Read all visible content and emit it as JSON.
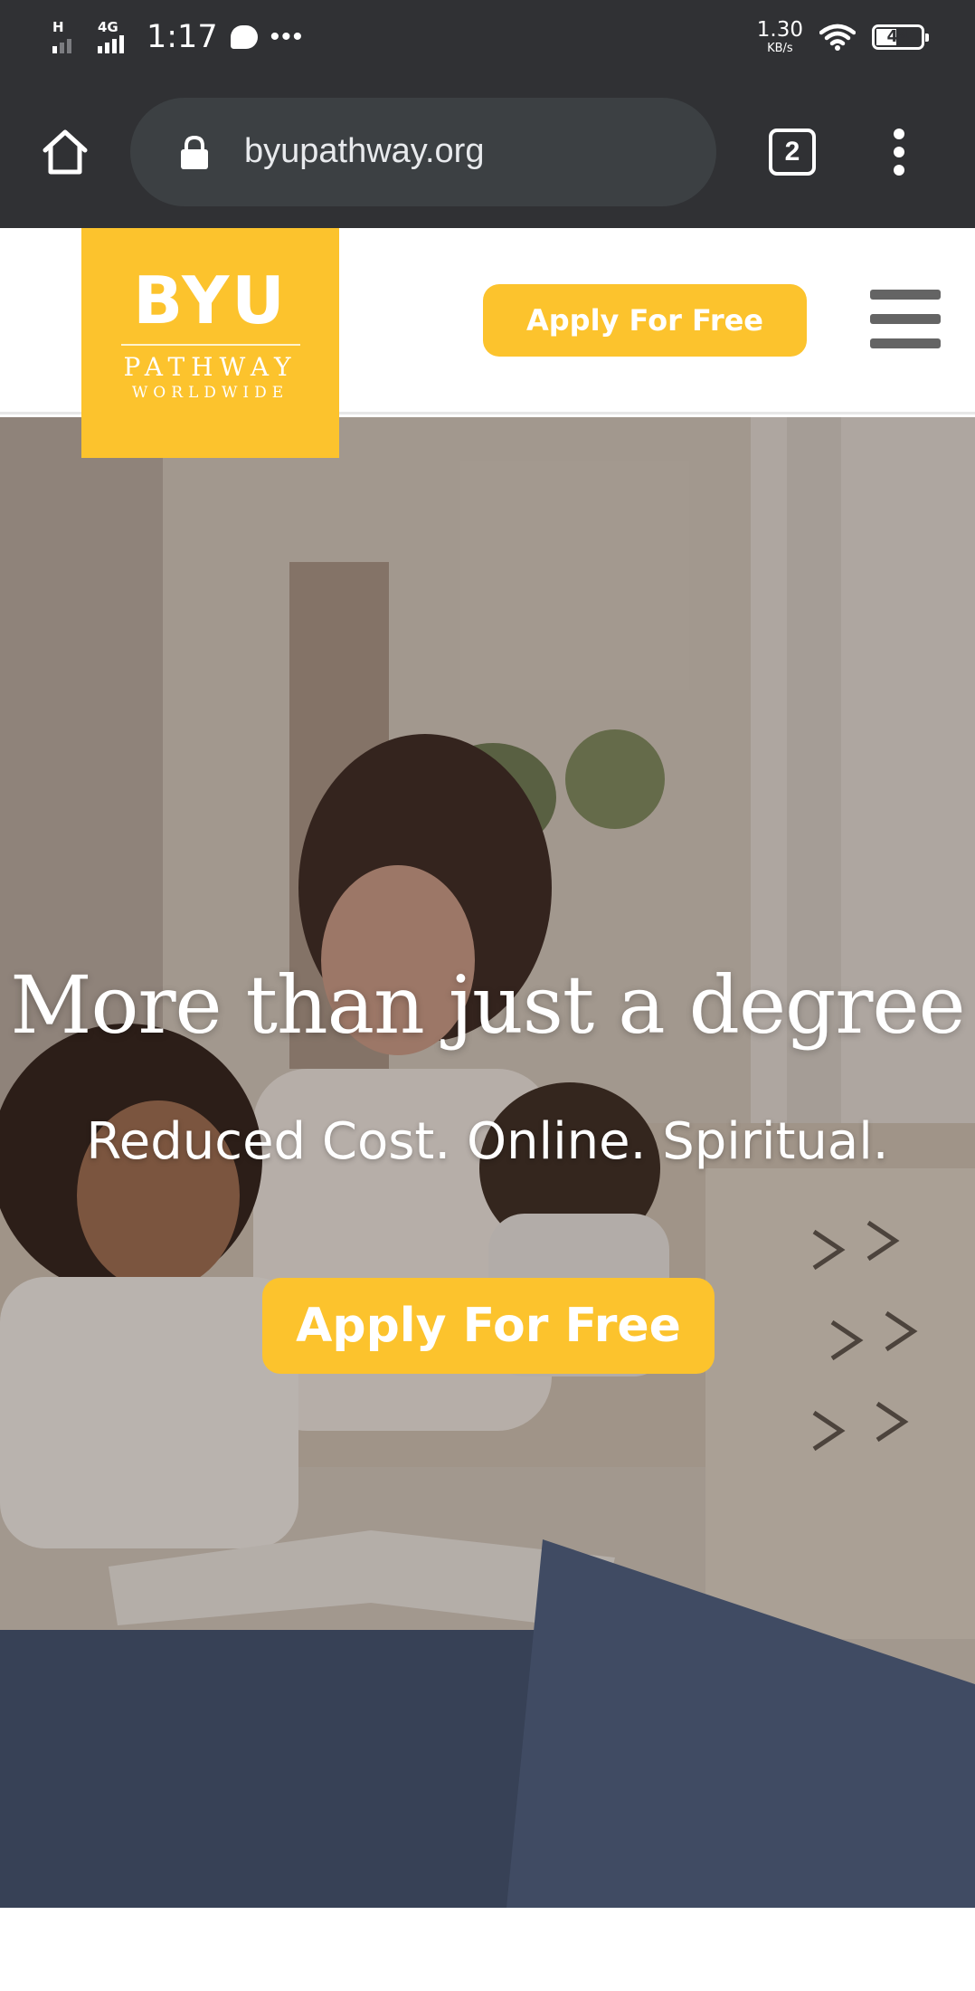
{
  "status_bar": {
    "network_type": "H",
    "network_type_2": "4G",
    "time": "1:17",
    "speed_value": "1.30",
    "speed_unit": "KB/s",
    "battery": "44",
    "icons": [
      "signal-icon",
      "chat-icon",
      "more-dots-icon",
      "wifi-icon",
      "battery-icon"
    ]
  },
  "browser": {
    "url": "byupathway.org",
    "tab_count": "2",
    "icons": [
      "home-icon",
      "lock-icon",
      "tabs-icon",
      "overflow-menu-icon"
    ]
  },
  "site_header": {
    "logo": {
      "line1": "BYU",
      "line2": "PATHWAY",
      "line3": "WORLDWIDE"
    },
    "apply_label": "Apply For Free",
    "menu_icon": "hamburger-menu-icon"
  },
  "hero": {
    "title": "More than just a degree",
    "subtitle": "Reduced Cost. Online. Spiritual.",
    "cta_label": "Apply For Free"
  },
  "colors": {
    "system_bar": "#303134",
    "url_field": "#3c4043",
    "brand_yellow": "#fcc32d",
    "menu_gray": "#646464",
    "text_white": "#ffffff"
  }
}
